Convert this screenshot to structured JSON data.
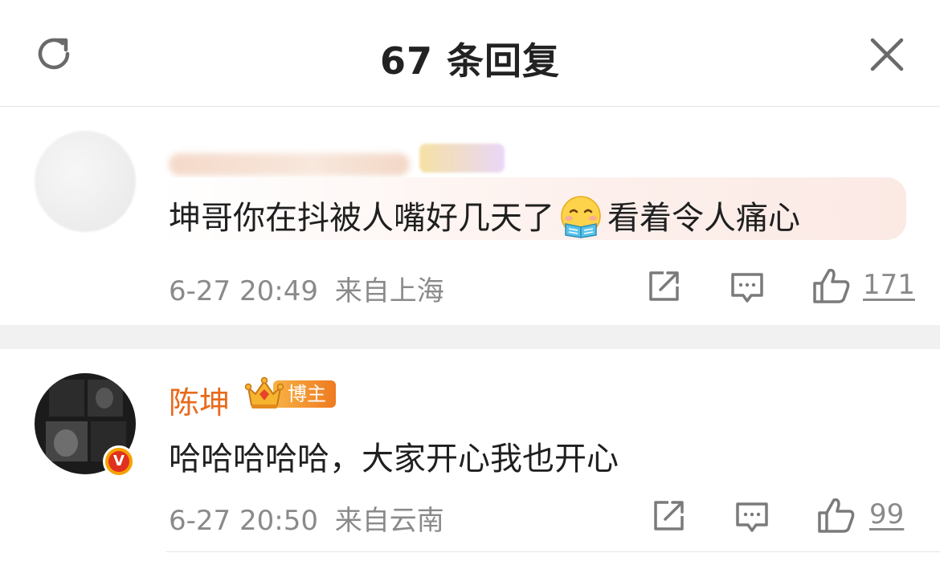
{
  "header": {
    "title": "67 条回复",
    "refresh_icon": "refresh-icon",
    "close_icon": "close-icon"
  },
  "comments": [
    {
      "username": "",
      "text_before_emoji": "坤哥你在抖被人嘴好几天了",
      "emoji": "reading-face-emoji",
      "text_after_emoji": "看着令人痛心",
      "time": "6-27 20:49",
      "location": "来自上海",
      "likes": "171"
    },
    {
      "username": "陈坤",
      "badge_label": "博主",
      "verified_mark": "V",
      "text": "哈哈哈哈哈，大家开心我也开心",
      "time": "6-27 20:50",
      "location": "来自云南",
      "likes": "99"
    }
  ],
  "colors": {
    "username": "#e86a1c",
    "meta": "#8a8a8a",
    "separator": "#f1f1f1",
    "bubble_tint": "#fbe9e4"
  }
}
